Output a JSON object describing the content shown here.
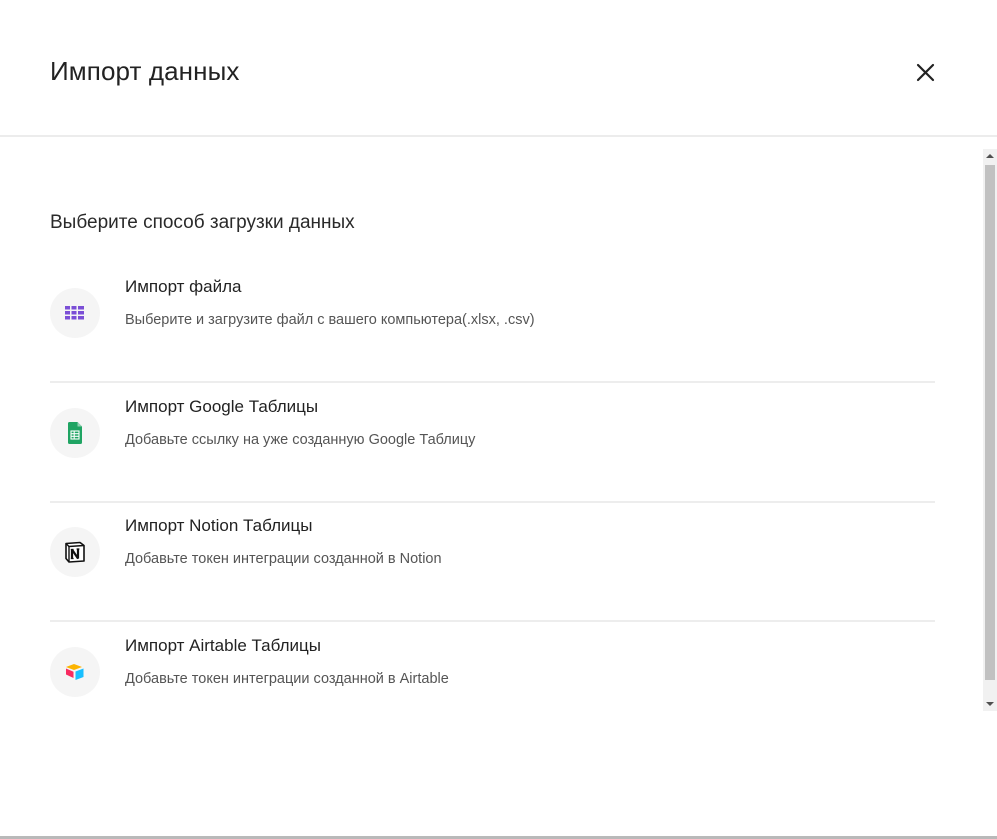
{
  "dialog": {
    "title": "Импорт данных",
    "close_icon": "close-icon"
  },
  "content": {
    "subtitle": "Выберите способ загрузки данных",
    "options": [
      {
        "title": "Импорт файла",
        "description": "Выберите и загрузите файл с вашего компьютера(.xlsx, .csv)",
        "icon": "table-grid-icon",
        "color": "#7b4fd6"
      },
      {
        "title": "Импорт Google Таблицы",
        "description": "Добавьте ссылку на уже созданную Google Таблицу",
        "icon": "google-sheets-icon",
        "color": "#1fa463"
      },
      {
        "title": "Импорт Notion Таблицы",
        "description": "Добавьте токен интеграции созданной в Notion",
        "icon": "notion-icon",
        "color": "#111111"
      },
      {
        "title": "Импорт Airtable Таблицы",
        "description": "Добавьте токен интеграции созданной в Airtable",
        "icon": "airtable-icon",
        "color": "#fcb400"
      }
    ]
  }
}
